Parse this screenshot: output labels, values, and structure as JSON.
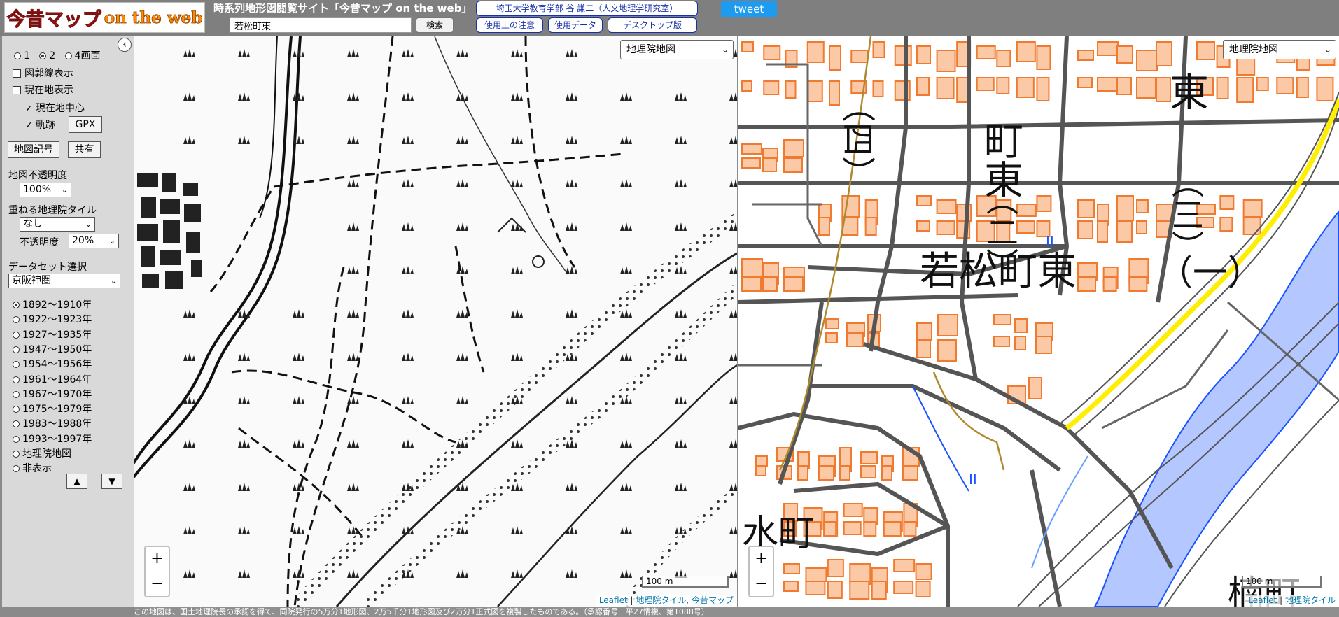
{
  "header": {
    "logo_main": "今昔マップ",
    "logo_sub": "on the web",
    "site_title": "時系列地形図閲覧サイト「今昔マップ on the web」",
    "search_value": "若松町東",
    "search_button": "検索",
    "credit": "埼玉大学教育学部 谷 謙二（人文地理学研究室）",
    "notes_button": "使用上の注意",
    "usage_button": "使用データ",
    "desktop_button": "デスクトップ版",
    "tweet_button": "tweet"
  },
  "sidebar": {
    "screens": [
      {
        "label": "1",
        "selected": false
      },
      {
        "label": "2",
        "selected": true
      },
      {
        "label": "4画面",
        "selected": false
      }
    ],
    "show_grid": "図郭線表示",
    "show_location": "現在地表示",
    "location_center": "現在地中心",
    "track": "軌跡",
    "gpx_button": "GPX",
    "symbols_button": "地図記号",
    "share_button": "共有",
    "opacity_label": "地図不透明度",
    "opacity_value": "100%",
    "overlay_label": "重ねる地理院タイル",
    "overlay_value": "なし",
    "overlay_opacity_label": "不透明度",
    "overlay_opacity_value": "20%",
    "dataset_label": "データセット選択",
    "dataset_value": "京阪神圏",
    "periods": [
      {
        "label": "1892～1910年",
        "selected": true
      },
      {
        "label": "1922～1923年",
        "selected": false
      },
      {
        "label": "1927～1935年",
        "selected": false
      },
      {
        "label": "1947～1950年",
        "selected": false
      },
      {
        "label": "1954～1956年",
        "selected": false
      },
      {
        "label": "1961～1964年",
        "selected": false
      },
      {
        "label": "1967～1970年",
        "selected": false
      },
      {
        "label": "1975～1979年",
        "selected": false
      },
      {
        "label": "1983～1988年",
        "selected": false
      },
      {
        "label": "1993～1997年",
        "selected": false
      },
      {
        "label": "地理院地図",
        "selected": false
      },
      {
        "label": "非表示",
        "selected": false
      }
    ],
    "up_button": "▲",
    "down_button": "▼",
    "collapse_icon": "‹"
  },
  "map_left": {
    "layer_select": "地理院地図",
    "zoom_in": "+",
    "zoom_out": "−",
    "scale": "100 m",
    "attribution": [
      "Leaflet",
      "地理院タイル, 今昔マップ"
    ]
  },
  "map_right": {
    "layer_select": "地理院地図",
    "zoom_in": "+",
    "zoom_out": "−",
    "scale": "100 m",
    "attribution": [
      "Leaflet",
      "地理院タイル"
    ],
    "labels": {
      "area_main": "若松町東",
      "area_4": "（四）",
      "area_2": "（二）",
      "area_3": "（三）",
      "area_1": "（一）",
      "town_higashi": "町東",
      "town_higashi2": "東",
      "mizu": "水町",
      "kusu": "楠町"
    }
  },
  "footer": "この地図は、国土地理院長の承認を得て、同院発行の5万分1地形図、2万5千分1地形図及び2万分1正式図を複製したものである。（承認番号　平27情複、第1088号）"
}
